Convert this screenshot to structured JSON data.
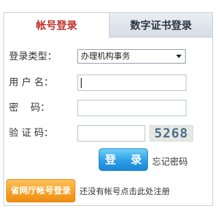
{
  "tabs": {
    "account_login": "帐号登录",
    "certificate_login": "数字证书登录"
  },
  "form": {
    "login_type_label": "登录类型：",
    "login_type_selected": "办理机构事务",
    "username_label": "用 户 名：",
    "username_value": "",
    "password_label": "密    码：",
    "password_value": "",
    "captcha_label": "验 证 码：",
    "captcha_value": "",
    "captcha_image_text": "5268"
  },
  "actions": {
    "login_button": "登 录",
    "forgot_password": "忘记密码",
    "province_login_button": "省网厅帐号登录",
    "register_text": "还没有帐号点击此处注册"
  },
  "icons": {
    "dropdown": "chevron-down-icon"
  },
  "colors": {
    "active_tab_text": "#c0302b",
    "login_button": "#2b9ee8",
    "province_button": "#f5a22a"
  }
}
